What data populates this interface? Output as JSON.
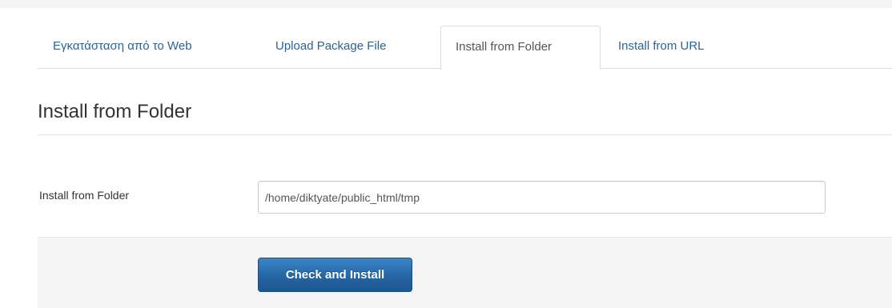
{
  "tabs": [
    {
      "label": "Εγκατάσταση από το Web",
      "active": false
    },
    {
      "label": "Upload Package File",
      "active": false
    },
    {
      "label": "Install from Folder",
      "active": true
    },
    {
      "label": "Install from URL",
      "active": false
    }
  ],
  "section": {
    "title": "Install from Folder"
  },
  "form": {
    "folder_label": "Install from Folder",
    "folder_value": "/home/diktyate/public_html/tmp"
  },
  "actions": {
    "install_label": "Check and Install"
  },
  "colors": {
    "link": "#2a6496",
    "active_tab_text": "#555555",
    "button_primary": "#2465a3",
    "actions_bg": "#f5f5f5"
  }
}
